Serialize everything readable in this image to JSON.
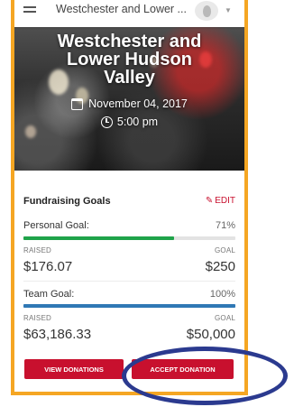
{
  "topbar": {
    "title": "Westchester and Lower ..."
  },
  "hero": {
    "title_line1": "Westchester and",
    "title_line2": "Lower Hudson",
    "title_line3": "Valley",
    "date": "November 04, 2017",
    "time": "5:00 pm"
  },
  "fundraising": {
    "section_title": "Fundraising Goals",
    "edit_label": "EDIT",
    "personal": {
      "label": "Personal Goal:",
      "percent": "71%",
      "progress_fraction": 0.71,
      "raised_label": "RAISED",
      "goal_label": "GOAL",
      "raised": "$176.07",
      "goal": "$250",
      "bar_color": "#1fa34a"
    },
    "team": {
      "label": "Team Goal:",
      "percent": "100%",
      "progress_fraction": 1.0,
      "raised_label": "RAISED",
      "goal_label": "GOAL",
      "raised": "$63,186.33",
      "goal": "$50,000",
      "bar_color": "#2f78b5"
    }
  },
  "actions": {
    "view_donations": "VIEW DONATIONS",
    "accept_donation": "ACCEPT DONATION"
  },
  "colors": {
    "accent_red": "#c8102e",
    "frame_orange": "#f5a623",
    "annotation_blue": "#2b3a8f"
  }
}
